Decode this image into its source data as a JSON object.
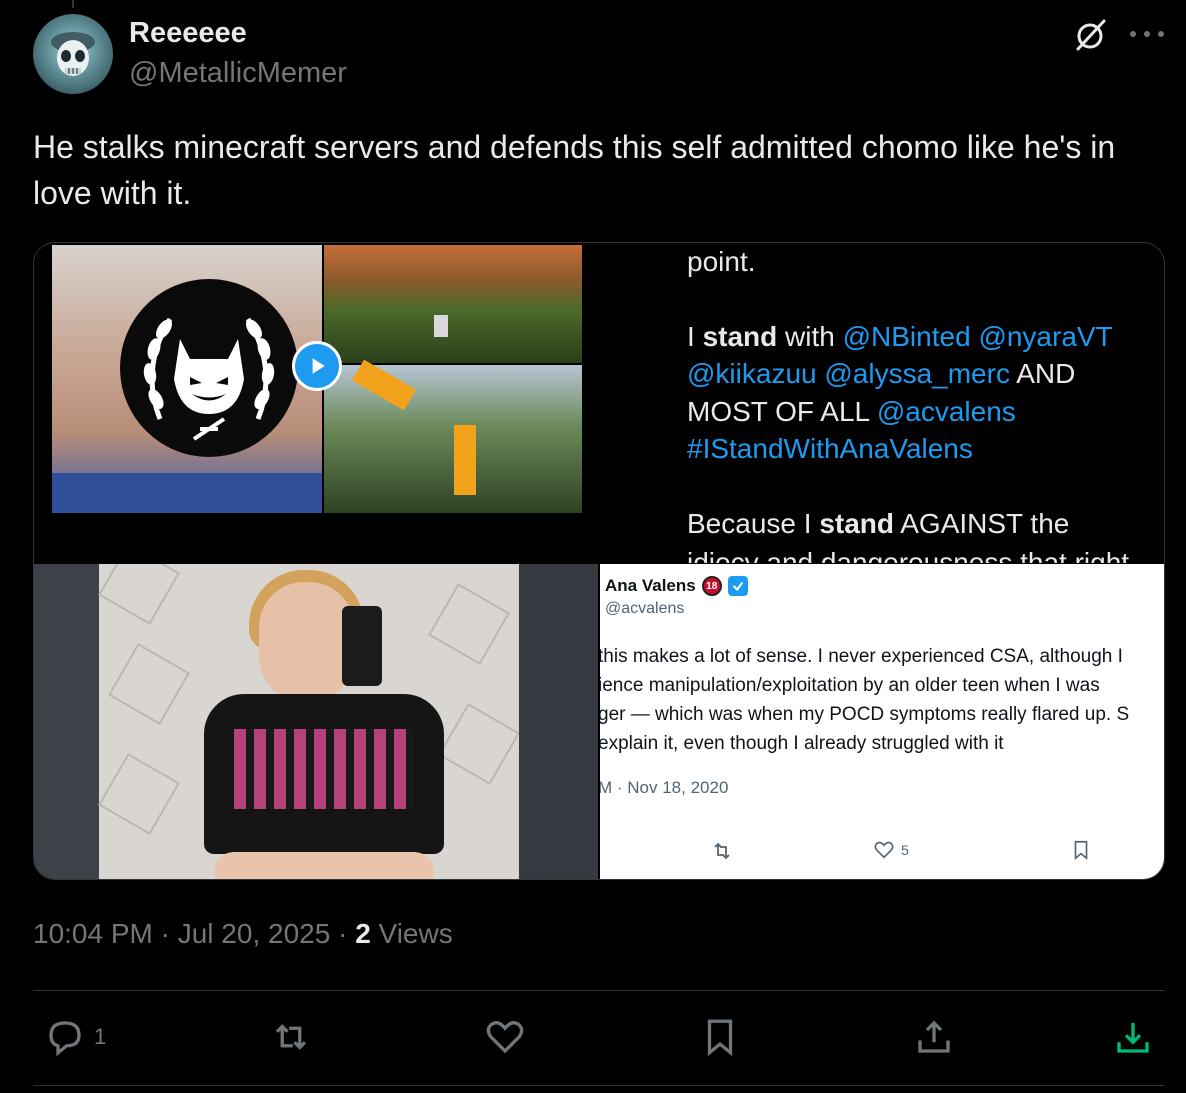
{
  "author": {
    "display_name": "Reeeeee",
    "handle": "@MetallicMemer"
  },
  "tweet": {
    "text": "He stalks minecraft servers and defends this self admitted chomo like he's in love with it."
  },
  "media": {
    "top_right": {
      "line1": "point.",
      "para2_prefix": "I ",
      "para2_bold": "stand",
      "para2_mid": " with ",
      "mention1": "@NBinted",
      "mention2": "@nyaraVT",
      "mention3": "@kiikazuu",
      "mention4": "@alyssa_merc",
      "and": " AND",
      "most": "MOST OF ALL ",
      "mention5": "@acvalens",
      "hashtag": "#IStandWithAnaValens",
      "para3_prefix": "Because I ",
      "para3_bold": "stand",
      "para3_suffix": " AGAINST the",
      "para3_cut": "idiocy and dangerousness that right"
    },
    "bottom_right": {
      "name": "Ana Valens",
      "badge": "18",
      "handle": "@acvalens",
      "lines": [
        "this makes a lot of sense. I never experienced CSA, although I",
        "ience manipulation/exploitation by an older teen when I was",
        "ger — which was when my POCD symptoms really flared up. S",
        "explain it, even though I already struggled with it"
      ],
      "date": "M · Nov 18, 2020",
      "like_count": "5"
    }
  },
  "meta": {
    "time": "10:04 PM · Jul 20, 2025 · ",
    "views_count": "2",
    "views_label": " Views"
  },
  "actions": {
    "reply_count": "1"
  },
  "colors": {
    "accent": "#1d9bf0",
    "muted": "#71767b",
    "download_green": "#00ba7c"
  }
}
